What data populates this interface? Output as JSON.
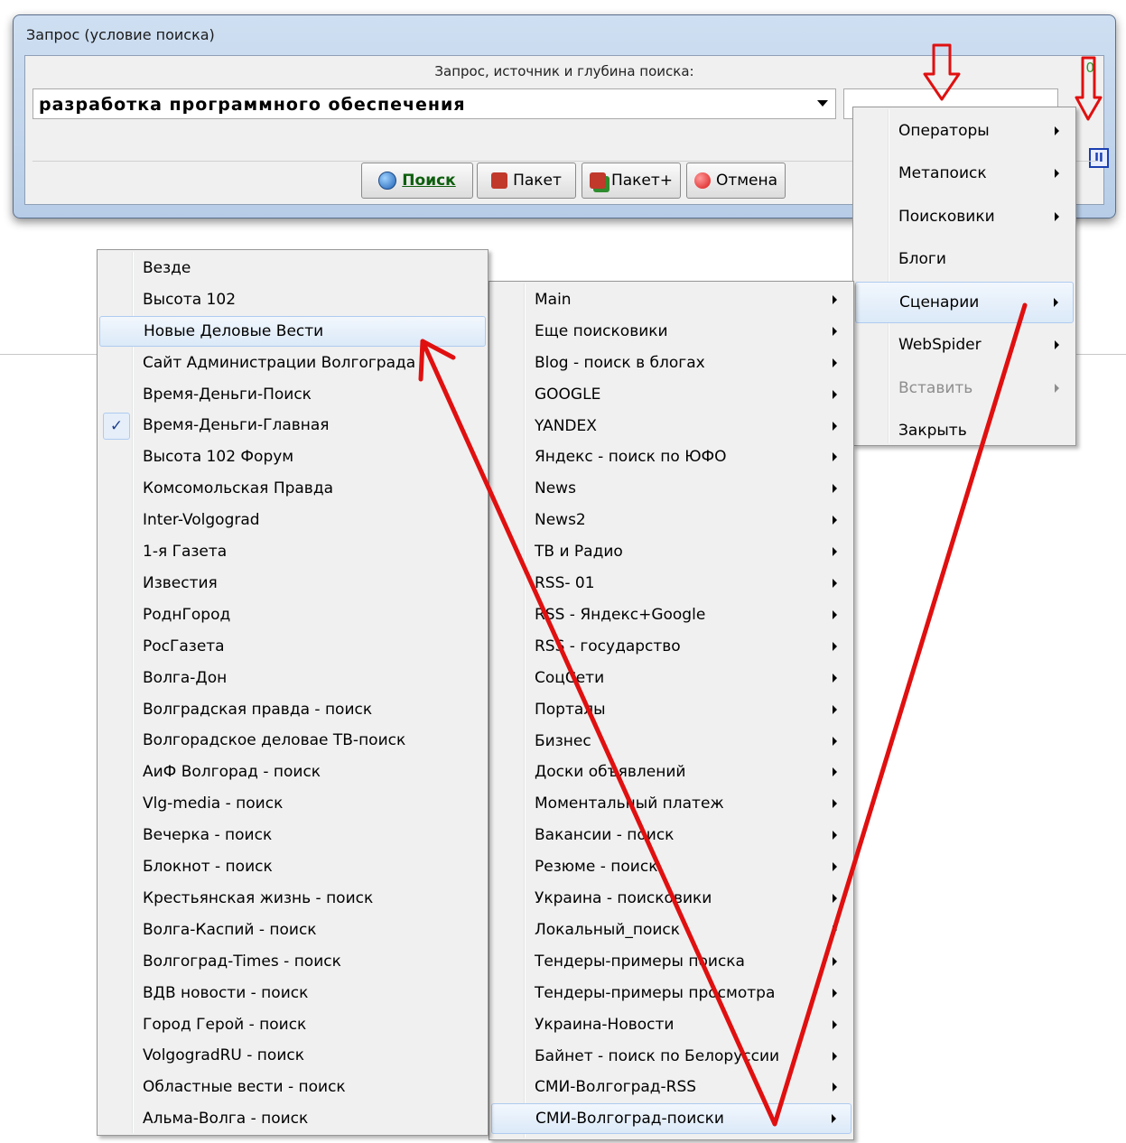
{
  "dialog": {
    "title": "Запрос (условие поиска)",
    "caption": "Запрос,  источник и  глубина поиска:",
    "counter": "0",
    "query_value": "разработка программного обеспечения",
    "depth_value": "",
    "buttons": {
      "search": "Поиск",
      "batch": "Пакет",
      "batch_plus": "Пакет+",
      "cancel": "Отмена"
    },
    "pause_glyph": "II"
  },
  "context_menu": {
    "items": [
      {
        "label": "Операторы",
        "submenu": true
      },
      {
        "label": "Метапоиск",
        "submenu": true
      },
      {
        "label": "Поисковики",
        "submenu": true
      },
      {
        "label": "Блоги",
        "submenu": false
      },
      {
        "label": "Сценарии",
        "submenu": true,
        "highlighted": true
      },
      {
        "label": "WebSpider",
        "submenu": true
      },
      {
        "label": "Вставить",
        "submenu": true,
        "disabled": true
      },
      {
        "label": "Закрыть",
        "submenu": false
      }
    ]
  },
  "scenarios_menu": {
    "items": [
      "Main",
      "Еще поисковики",
      "Blog - поиск в блогах",
      "GOOGLE",
      "YANDEX",
      "Яндекс - поиск по ЮФО",
      "News",
      "News2",
      "ТВ и Радио",
      "RSS- 01",
      "RSS - Яндекс+Google",
      "RSS - государство",
      "СоцСети",
      "Порталы",
      "Бизнес",
      "Доски объявлений",
      "Моментальный платеж",
      "Вакансии - поиск",
      "Резюме - поиск",
      "Украина - поисковики",
      "Локальный_поиск",
      "Тендеры-примеры поиска",
      "Тендеры-примеры просмотра",
      "Украина-Новости",
      "Байнет - поиск по Белоруссии",
      "СМИ-Волгоград-RSS",
      "СМИ-Волгоград-поиски"
    ],
    "highlighted_index": 26
  },
  "media_menu": {
    "items": [
      "Везде",
      "Высота 102",
      "Новые Деловые Вести",
      "Сайт Администрации Волгограда",
      "Время-Деньги-Поиск",
      "Время-Деньги-Главная",
      "Высота 102 Форум",
      "Комсомольская Правда",
      "Inter-Volgograd",
      "1-я Газета",
      "Известия",
      "РоднГород",
      "РосГазета",
      "Волга-Дон",
      "Волградская правда - поиск",
      "Волгорадское деловае ТВ-поиск",
      "АиФ Волгорад - поиск",
      "Vlg-media - поиск",
      "Вечерка - поиск",
      "Блокнот - поиск",
      "Крестьянская жизнь - поиск",
      "Волга-Каспий - поиск",
      "Волгоград-Times - поиск",
      "ВДВ новости - поиск",
      "Город Герой - поиск",
      "VolgogradRU - поиск",
      "Областные вести - поиск",
      "Альма-Волга - поиск"
    ],
    "highlighted_index": 2,
    "checked_index": 5,
    "check_glyph": "✓"
  },
  "annotations": {
    "arrow_color": "#e01010"
  }
}
